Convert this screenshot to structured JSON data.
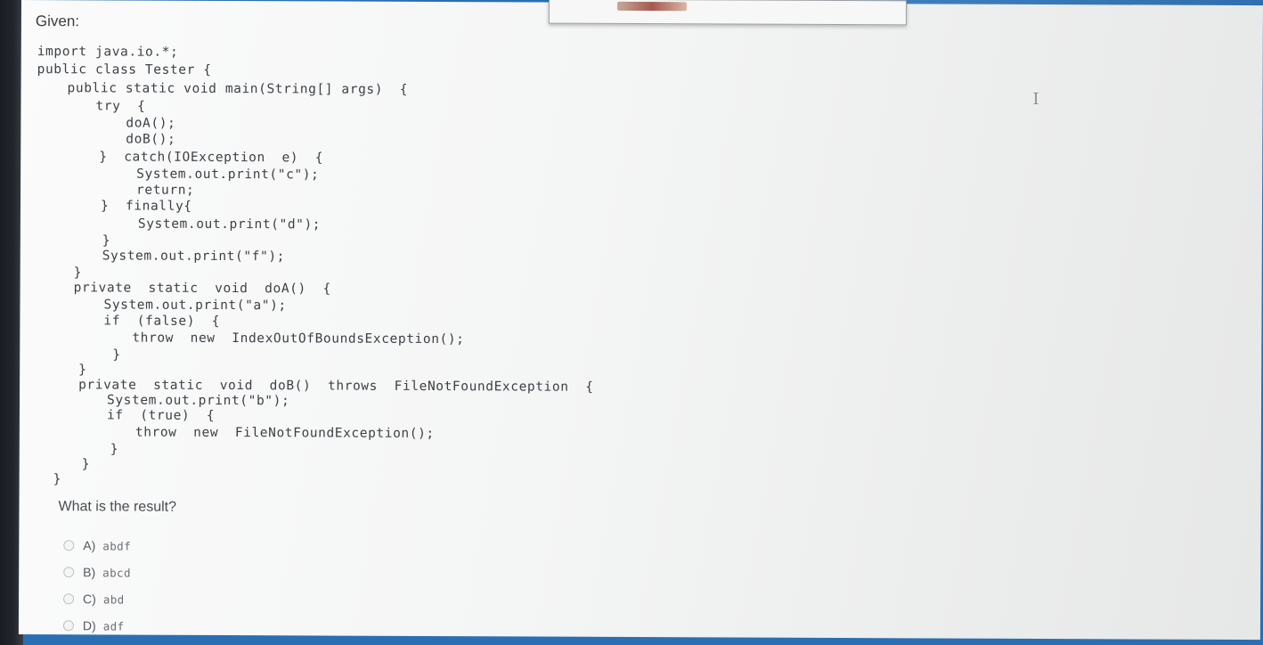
{
  "heading": "Given:",
  "code_lines": [
    "import java.io.*;",
    "public class Tester {",
    "public static void main(String[] args)  {",
    "try  {",
    "doA();",
    "doB();",
    "}  catch(IOException  e)  {",
    "System.out.print(\"c\");",
    "return;",
    "}  finally{",
    "System.out.print(\"d\");",
    "}",
    "System.out.print(\"f\");",
    "}",
    "private  static  void  doA()  {",
    "System.out.print(\"a\");",
    "if  (false)  {",
    "throw  new  IndexOutOfBoundsException();",
    "}",
    "}",
    "private  static  void  doB()  throws  FileNotFoundException  {",
    "System.out.print(\"b\");",
    "if  (true)  {",
    "throw  new  FileNotFoundException();",
    "}",
    "}",
    "}"
  ],
  "question": "What is the result?",
  "options": [
    {
      "letter": "A)",
      "text": "abdf"
    },
    {
      "letter": "B)",
      "text": "abcd"
    },
    {
      "letter": "C)",
      "text": "abd"
    },
    {
      "letter": "D)",
      "text": "adf"
    }
  ],
  "text_cursor_glyph": "I"
}
